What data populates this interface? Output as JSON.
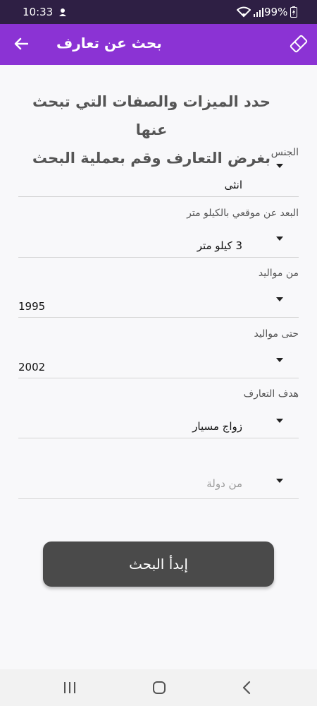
{
  "status_bar": {
    "time": "10:33",
    "battery": "99%"
  },
  "app_bar": {
    "title": "بحث عن تعارف"
  },
  "heading": {
    "line1": "حدد الميزات والصفات التي تبحث عنها",
    "line2": "بغرض التعارف وقم بعملية البحث"
  },
  "form": {
    "gender": {
      "label": "الجنس",
      "value": "انثى"
    },
    "distance": {
      "label": "البعد عن موقعي بالكيلو متر",
      "value": "3 كيلو متر"
    },
    "birth_from": {
      "label": "من مواليد",
      "value": "1995"
    },
    "birth_to": {
      "label": "حتى مواليد",
      "value": "2002"
    },
    "goal": {
      "label": "هدف التعارف",
      "value": "زواج مسيار"
    },
    "country": {
      "placeholder": "من دولة"
    }
  },
  "search_button": {
    "label": "إبدأ البحث"
  },
  "icons": {
    "back": "arrow-left-icon",
    "eraser": "eraser-icon",
    "recents": "recents-icon",
    "home": "home-icon",
    "nav_back": "chevron-left-icon"
  },
  "colors": {
    "app_bar": "#8b33d4",
    "status_bar": "#2e1f44",
    "button": "#4a4a4a"
  }
}
